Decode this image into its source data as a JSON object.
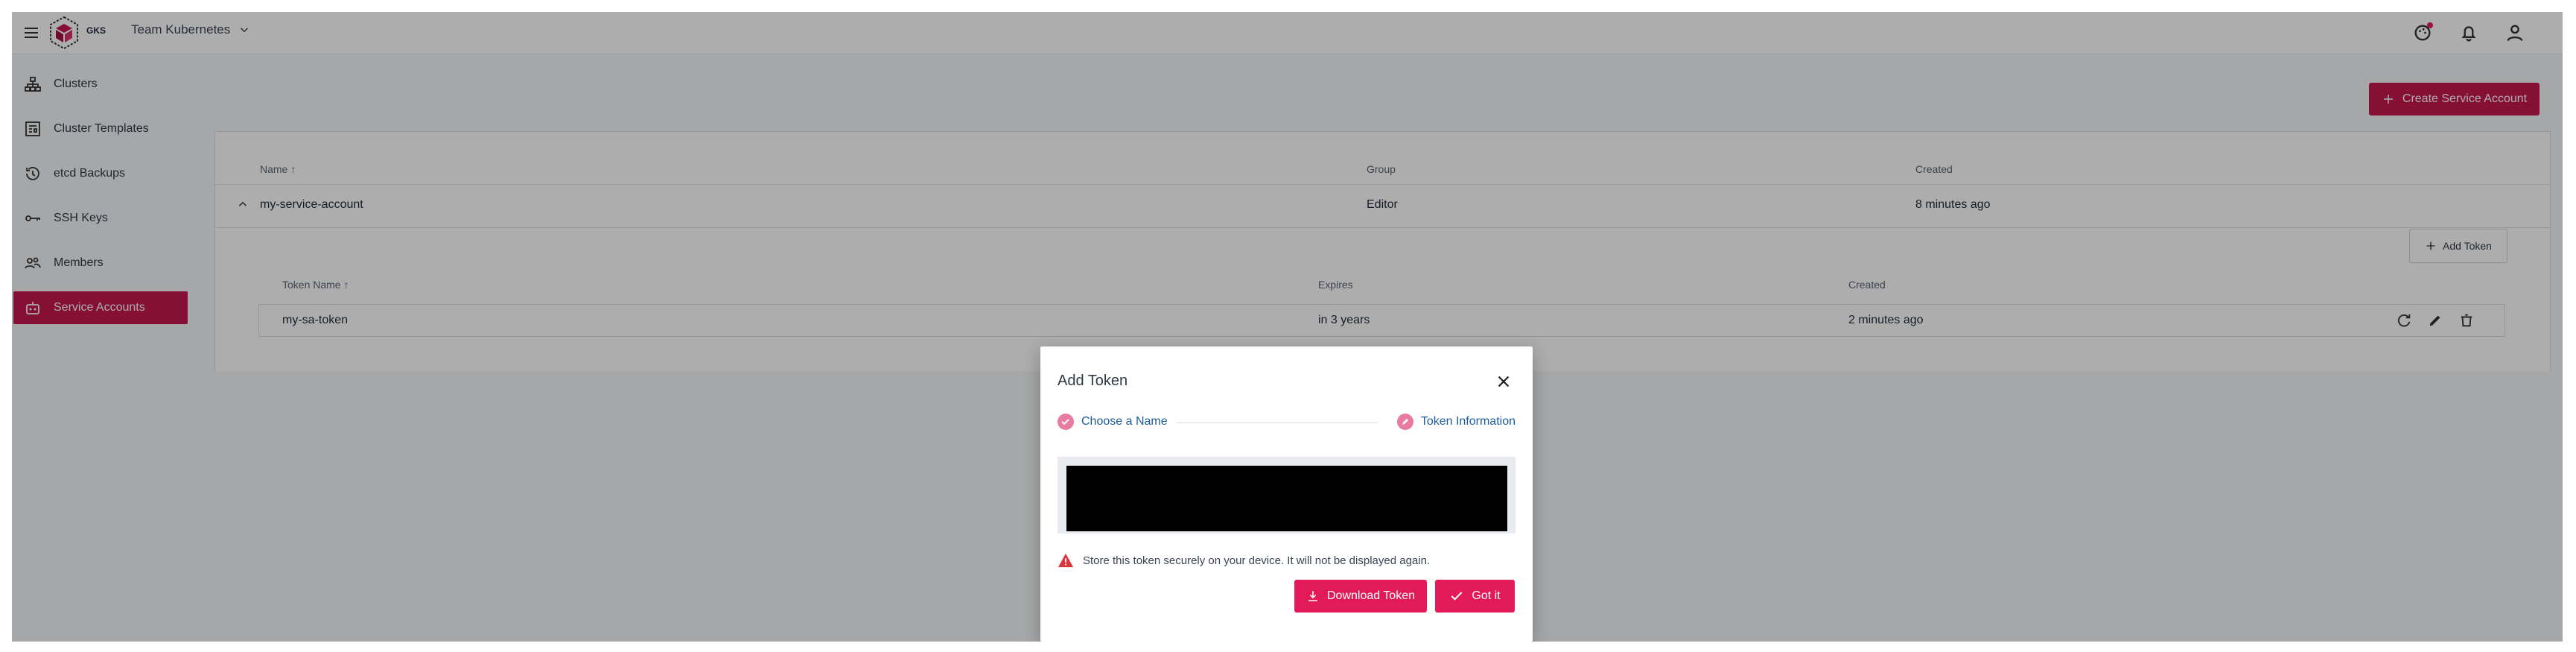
{
  "topbar": {
    "logo_text": "GKS",
    "project_name": "Team Kubernetes"
  },
  "sidebar": {
    "items": [
      {
        "label": "Clusters",
        "icon": "sitemap-icon"
      },
      {
        "label": "Cluster Templates",
        "icon": "template-icon"
      },
      {
        "label": "etcd Backups",
        "icon": "history-icon"
      },
      {
        "label": "SSH Keys",
        "icon": "key-icon"
      },
      {
        "label": "Members",
        "icon": "members-icon"
      },
      {
        "label": "Service Accounts",
        "icon": "robot-icon",
        "active": true
      }
    ]
  },
  "main": {
    "create_button": "Create Service Account",
    "table": {
      "headers": {
        "name": "Name",
        "group": "Group",
        "created": "Created"
      },
      "rows": [
        {
          "name": "my-service-account",
          "group": "Editor",
          "created": "8 minutes ago"
        }
      ]
    },
    "tokens": {
      "add_token": "Add Token",
      "headers": {
        "name": "Token Name",
        "expires": "Expires",
        "created": "Created"
      },
      "rows": [
        {
          "name": "my-sa-token",
          "expires": "in 3 years",
          "created": "2 minutes ago"
        }
      ]
    }
  },
  "dialog": {
    "title": "Add Token",
    "steps": [
      {
        "label": "Choose a Name"
      },
      {
        "label": "Token Information"
      }
    ],
    "warning": "Store this token securely on your device. It will not be displayed again.",
    "download_button": "Download Token",
    "ok_button": "Got it"
  },
  "colors": {
    "accent": "#c5174f",
    "accent_bright": "#e21a5a",
    "step_text": "#1c5d99"
  }
}
